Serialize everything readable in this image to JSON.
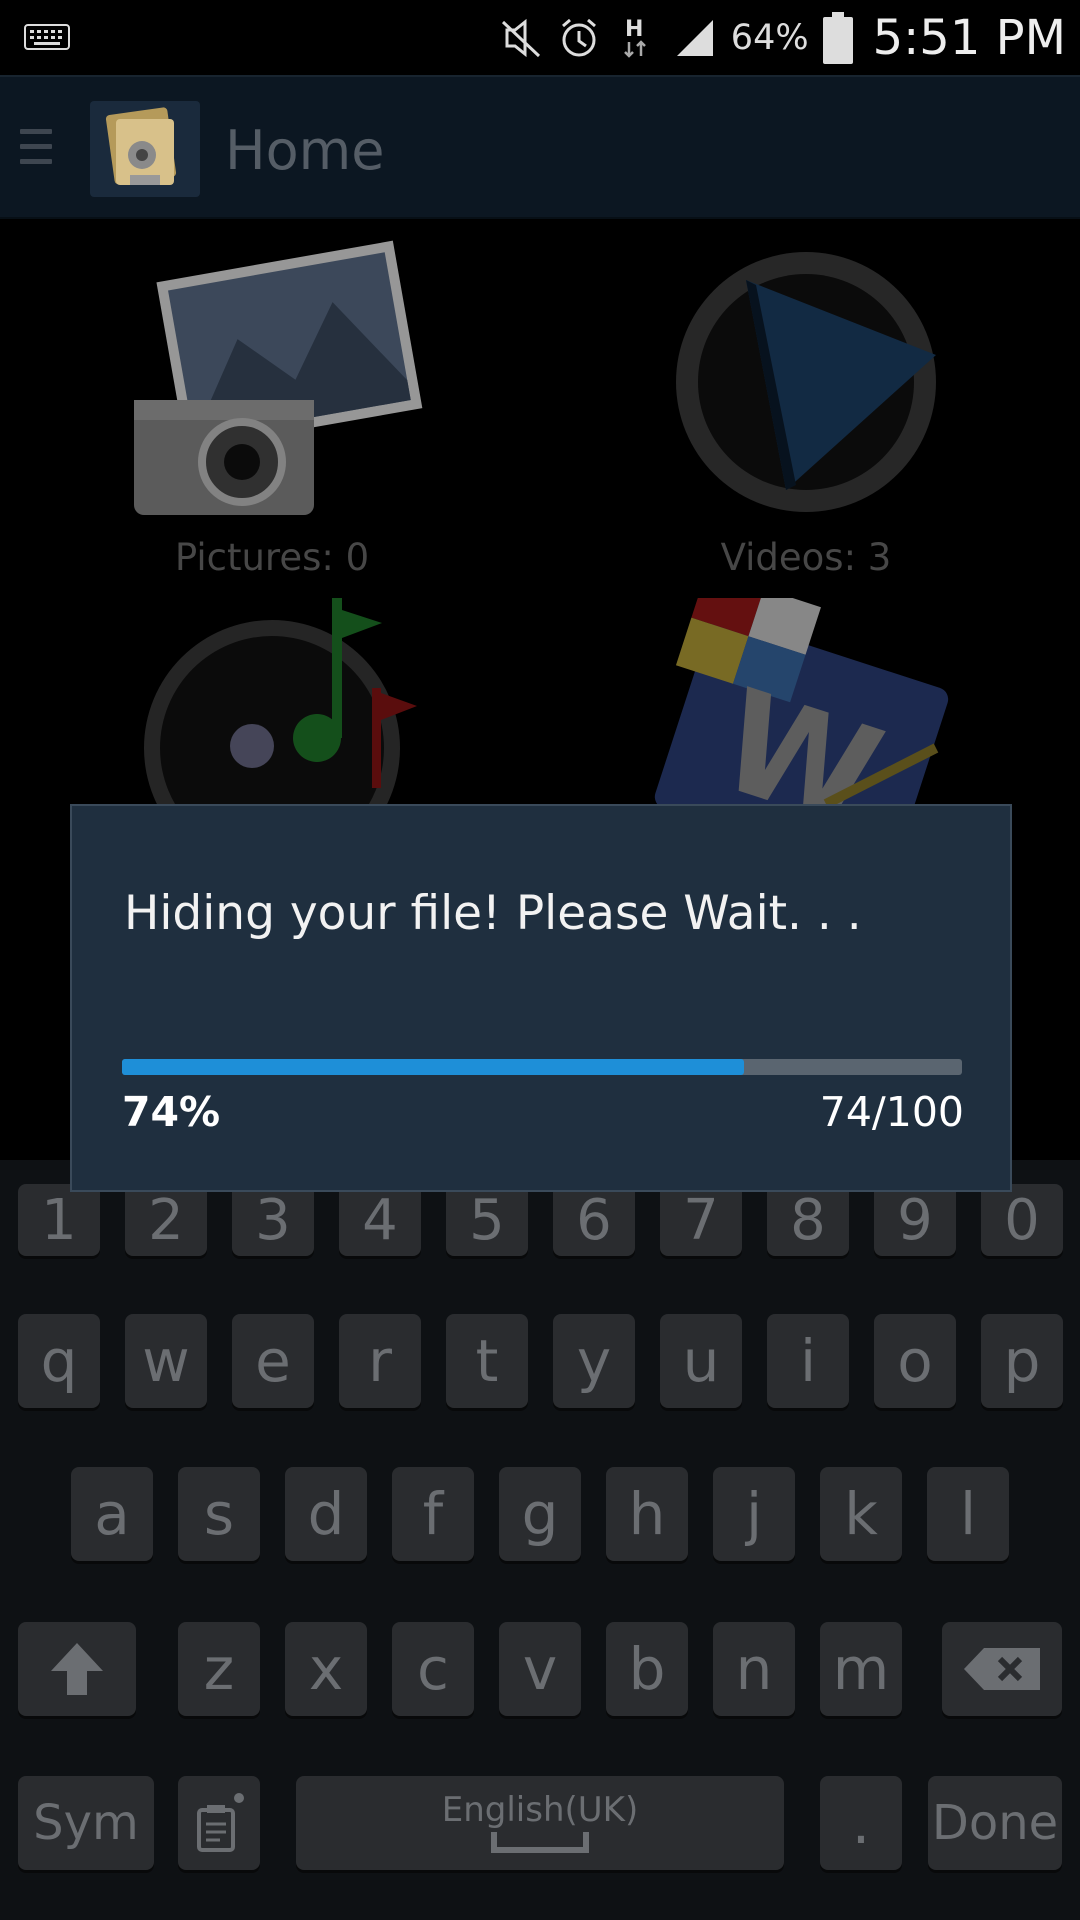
{
  "status_bar": {
    "battery": "64%",
    "time": "5:51 PM",
    "network_type": "H",
    "icons": [
      "keyboard-icon",
      "mute-icon",
      "alarm-icon",
      "network-h-icon",
      "signal-icon",
      "battery-icon"
    ]
  },
  "action_bar": {
    "title": "Home",
    "menu_icon": "hamburger-icon",
    "app_icon": "folder-lock-icon"
  },
  "tiles": [
    {
      "label": "Pictures: 0",
      "icon": "pictures-icon"
    },
    {
      "label": "Videos: 3",
      "icon": "videos-icon"
    },
    {
      "label": "",
      "icon": "music-icon"
    },
    {
      "label": "",
      "icon": "documents-icon"
    }
  ],
  "dialog": {
    "message": "Hiding your file! Please Wait. . .",
    "progress_fraction": 0.74,
    "percent_label": "74%",
    "count_label": "74/100",
    "progress_color": "#1e8fd8"
  },
  "keyboard": {
    "row_numbers": [
      "1",
      "2",
      "3",
      "4",
      "5",
      "6",
      "7",
      "8",
      "9",
      "0"
    ],
    "row_top": [
      "q",
      "w",
      "e",
      "r",
      "t",
      "y",
      "u",
      "i",
      "o",
      "p"
    ],
    "row_mid": [
      "a",
      "s",
      "d",
      "f",
      "g",
      "h",
      "j",
      "k",
      "l"
    ],
    "row_bottom": [
      "z",
      "x",
      "c",
      "v",
      "b",
      "n",
      "m"
    ],
    "sym_label": "Sym",
    "space_label": "English(UK)",
    "period_label": ".",
    "done_label": "Done"
  }
}
